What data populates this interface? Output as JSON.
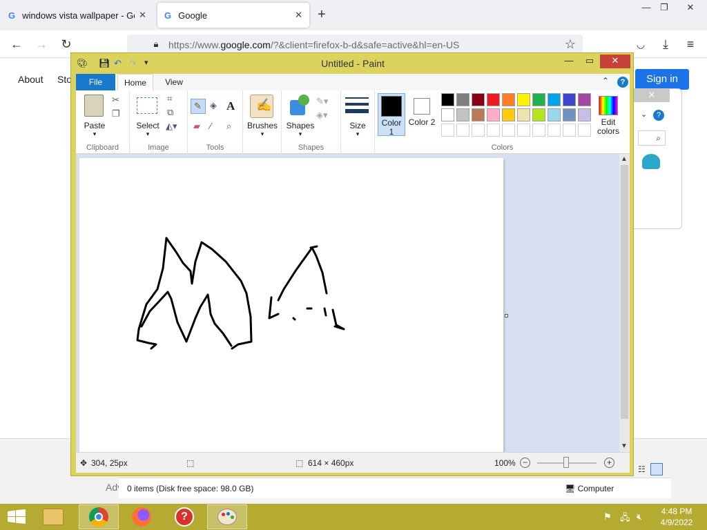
{
  "browser": {
    "tabs": [
      {
        "title": "windows vista wallpaper - Goog",
        "favicon": "G"
      },
      {
        "title": "Google",
        "favicon": "G"
      }
    ],
    "new_tab": "+",
    "url": {
      "pre": "https://www.",
      "domain": "google.com",
      "post": "/?&client=firefox-b-d&safe=active&hl=en-US"
    }
  },
  "google_page": {
    "about": "About",
    "store": "Sto",
    "sign_in": "Sign in",
    "advertising": "Adv"
  },
  "paint": {
    "title": "Untitled - Paint",
    "tabs": {
      "file": "File",
      "home": "Home",
      "view": "View"
    },
    "groups": {
      "clipboard": "Clipboard",
      "image": "Image",
      "tools": "Tools",
      "shapes": "Shapes",
      "colors": "Colors"
    },
    "buttons": {
      "paste": "Paste",
      "select": "Select",
      "brushes": "Brushes",
      "shapes": "Shapes",
      "size": "Size",
      "color1": "Color 1",
      "color2": "Color 2",
      "edit_colors": "Edit colors"
    },
    "palette_row1": [
      "#000000",
      "#7f7f7f",
      "#880015",
      "#ed1c24",
      "#ff7f27",
      "#fff200",
      "#22b14c",
      "#00a2e8",
      "#3f48cc",
      "#a349a4"
    ],
    "palette_row2": [
      "#ffffff",
      "#c3c3c3",
      "#b97a57",
      "#ffaec9",
      "#ffc90e",
      "#efe4b0",
      "#b5e61d",
      "#99d9ea",
      "#7092be",
      "#c8bfe7"
    ],
    "status": {
      "cursor": "304, 25px",
      "canvas_size": "614 × 460px",
      "zoom": "100%"
    }
  },
  "explorer": {
    "items": "0 items (Disk free space: 98.0 GB)",
    "location": "Computer"
  },
  "taskbar": {
    "time": "4:48 PM",
    "date": "4/9/2022"
  }
}
